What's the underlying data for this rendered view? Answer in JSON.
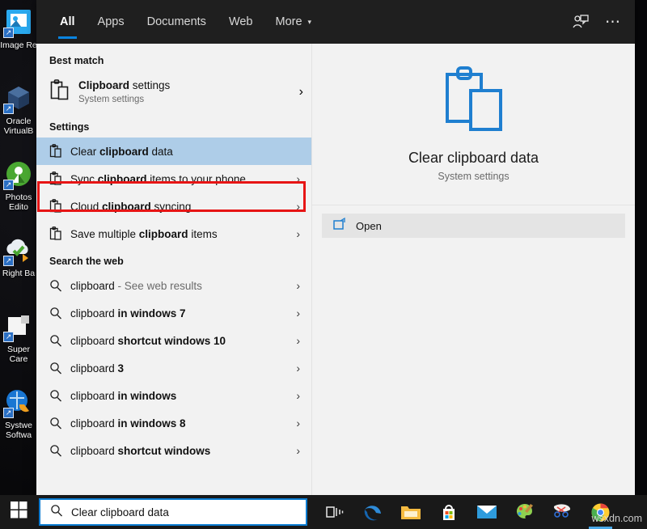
{
  "desktop": {
    "icons": [
      {
        "label": "Image Re",
        "icon": "image-resizer-icon"
      },
      {
        "label": "Oracle\nVirtualB",
        "icon": "virtualbox-icon"
      },
      {
        "label": "Photos\nEdito",
        "icon": "photos-editor-icon"
      },
      {
        "label": "Right Ba",
        "icon": "right-backup-icon"
      },
      {
        "label": "Super\nCare",
        "icon": "super-care-icon"
      },
      {
        "label": "Systwe\nSoftwa",
        "icon": "systweak-software-icon"
      }
    ]
  },
  "tabs": [
    {
      "label": "All",
      "active": true
    },
    {
      "label": "Apps",
      "active": false
    },
    {
      "label": "Documents",
      "active": false
    },
    {
      "label": "Web",
      "active": false
    },
    {
      "label": "More",
      "active": false,
      "caret": "▾"
    }
  ],
  "tab_actions": {
    "feedback": "feedback-icon",
    "more": "⋯"
  },
  "results": {
    "best_match_head": "Best match",
    "best_match": {
      "title_bold": "Clipboard",
      "title_rest": " settings",
      "subtitle": "System settings",
      "chevron": "›",
      "icon": "clipboard-icon"
    },
    "settings_head": "Settings",
    "settings": [
      {
        "pre": "Clear ",
        "bold": "clipboard",
        "post": " data",
        "selected": true,
        "chevron": ""
      },
      {
        "pre": "Sync ",
        "bold": "clipboard",
        "post": " items to your phone",
        "selected": false,
        "chevron": "›"
      },
      {
        "pre": "Cloud ",
        "bold": "clipboard",
        "post": " syncing",
        "selected": false,
        "chevron": "›"
      },
      {
        "pre": "Save multiple ",
        "bold": "clipboard",
        "post": " items",
        "selected": false,
        "chevron": "›"
      }
    ],
    "web_head": "Search the web",
    "web": [
      {
        "pre": "clipboard",
        "bold": "",
        "post": " - See web results",
        "chevron": "›",
        "dim_post": true
      },
      {
        "pre": "clipboard ",
        "bold": "in windows 7",
        "post": "",
        "chevron": "›"
      },
      {
        "pre": "clipboard ",
        "bold": "shortcut windows 10",
        "post": "",
        "chevron": "›"
      },
      {
        "pre": "clipboard ",
        "bold": "3",
        "post": "",
        "chevron": "›"
      },
      {
        "pre": "clipboard ",
        "bold": "in windows",
        "post": "",
        "chevron": "›"
      },
      {
        "pre": "clipboard ",
        "bold": "in windows 8",
        "post": "",
        "chevron": "›"
      },
      {
        "pre": "clipboard ",
        "bold": "shortcut windows",
        "post": "",
        "chevron": "›"
      }
    ]
  },
  "preview": {
    "icon": "clipboard-icon",
    "title": "Clear clipboard data",
    "subtitle": "System settings",
    "open_label": "Open",
    "open_icon": "open-external-icon"
  },
  "taskbar": {
    "start_icon": "windows-logo-icon",
    "search_value": "Clear clipboard data",
    "search_icon": "search-icon",
    "icons": [
      {
        "name": "task-view-icon"
      },
      {
        "name": "edge-icon"
      },
      {
        "name": "file-explorer-icon"
      },
      {
        "name": "microsoft-store-icon"
      },
      {
        "name": "mail-icon"
      },
      {
        "name": "paint-3d-icon"
      },
      {
        "name": "snip-tool-icon"
      },
      {
        "name": "chrome-icon"
      }
    ],
    "watermark": "wsxdn.com"
  },
  "colors": {
    "accent": "#0a84e0",
    "selection": "#aecde8",
    "annotation": "#e71515",
    "panel_bg": "#f2f2f2",
    "tabbar_bg": "#1f1f1f"
  }
}
